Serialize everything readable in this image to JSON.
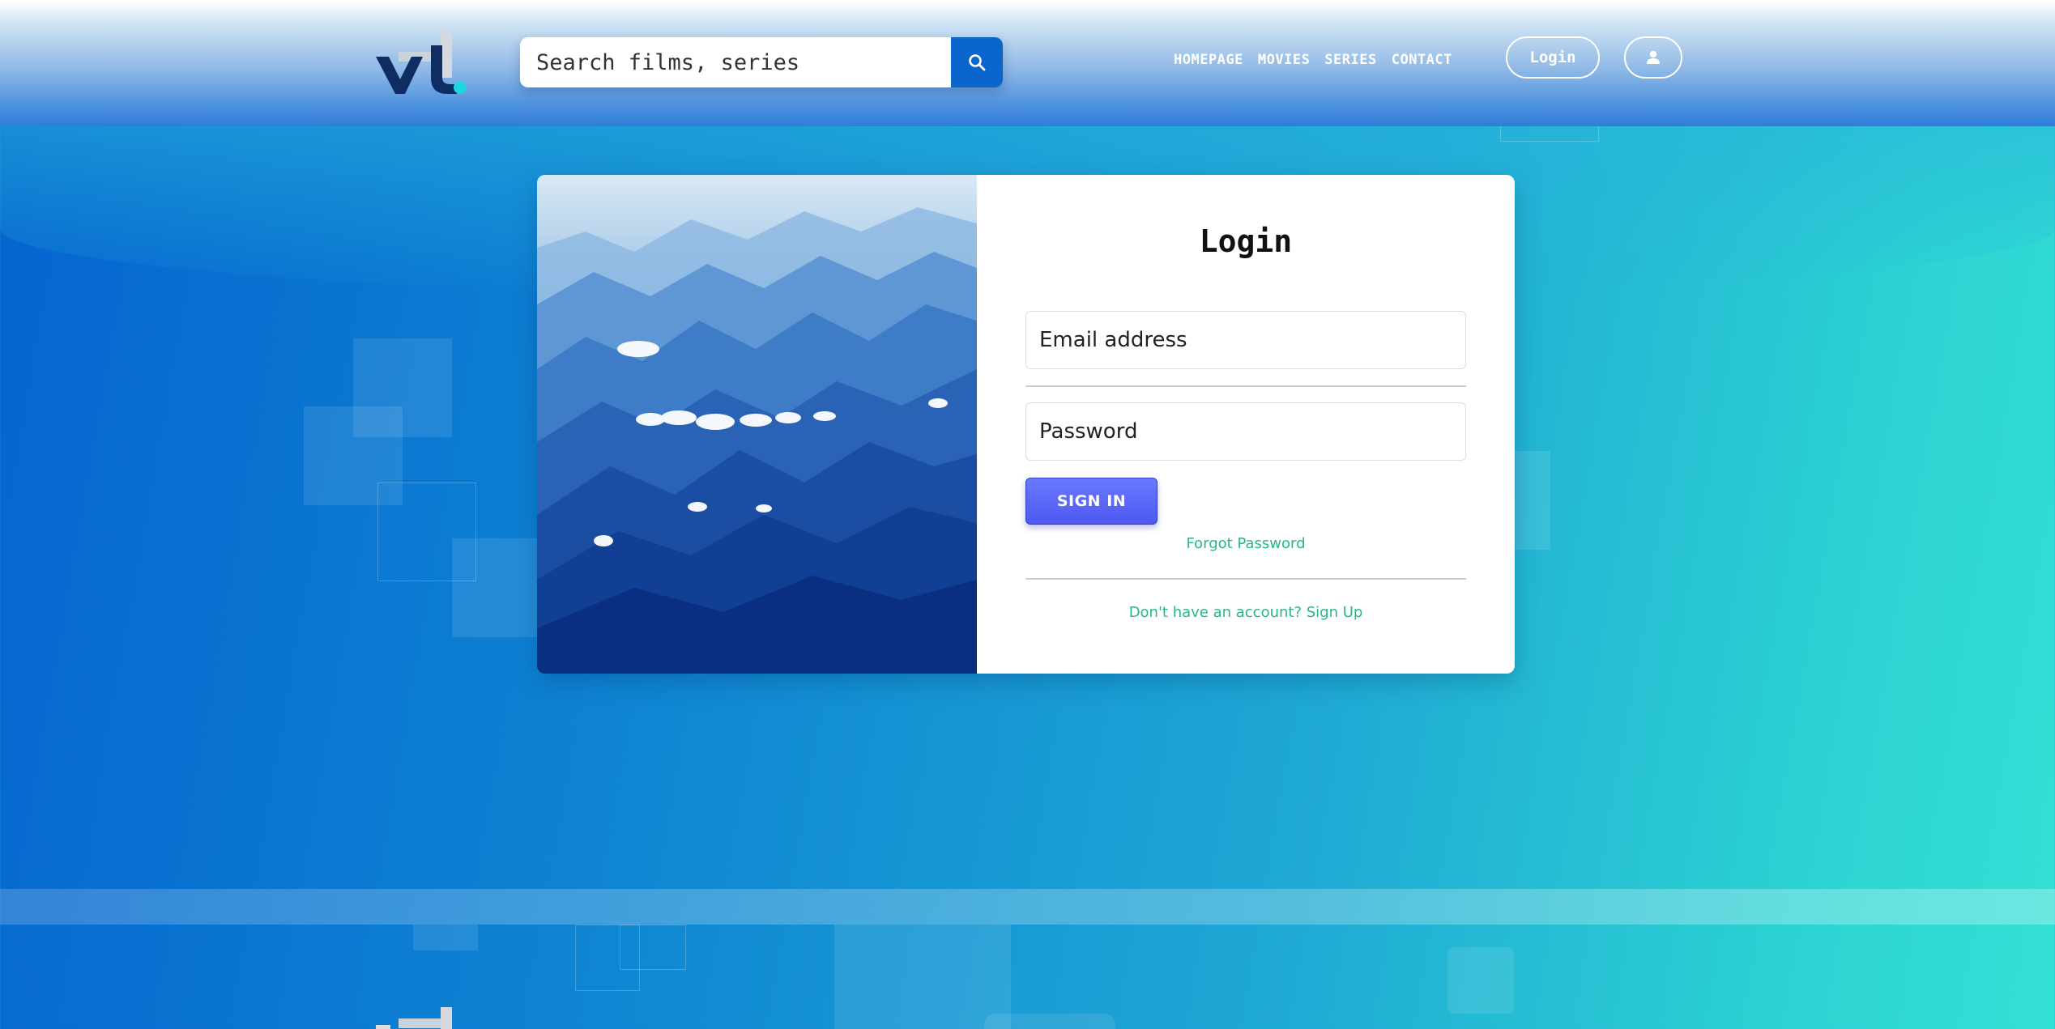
{
  "header": {
    "search": {
      "placeholder": "Search films, series"
    },
    "nav": [
      "HOMEPAGE",
      "MOVIES",
      "SERIES",
      "CONTACT"
    ],
    "login_label": "Login",
    "icons": {
      "search": "search-icon",
      "user": "user-icon"
    }
  },
  "login_form": {
    "title": "Login",
    "email_placeholder": "Email address",
    "password_placeholder": "Password",
    "submit_label": "SIGN IN",
    "forgot_label": "Forgot Password",
    "signup_label": "Don't have an account? Sign Up"
  },
  "colors": {
    "link": "#26b887",
    "button": "#5663f6",
    "header_search_button": "#0a66cc",
    "logo_dark": "#0f2c63",
    "logo_accent": "#1fd6e0"
  }
}
